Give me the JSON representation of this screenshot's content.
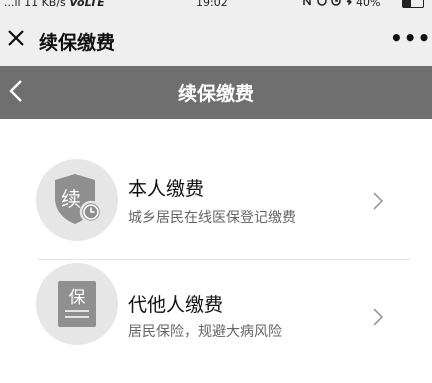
{
  "status_bar": {
    "network": "...ıl 11 KB/s",
    "volte": "VoLTE",
    "time": "19:02",
    "icons": [
      "nfc-icon",
      "alarm-icon",
      "bluetooth-icon"
    ],
    "battery": "40%"
  },
  "title_bar": {
    "title": "续保缴费",
    "more": "•••"
  },
  "nav_bar": {
    "title": "续保缴费"
  },
  "items": [
    {
      "title": "本人缴费",
      "description": "城乡居民在线医保登记缴费",
      "icon_char": "续",
      "icon": "renew-shield-clock-icon"
    },
    {
      "title": "代他人缴费",
      "description": "居民保险，规避大病风险",
      "icon_char": "保",
      "icon": "insurance-document-icon"
    }
  ],
  "colors": {
    "status_bar_bg": "#efefef",
    "nav_bar_bg": "#6f6f6f",
    "icon_circle": "#e6e6e6",
    "icon_inner": "#8f8f8f"
  }
}
